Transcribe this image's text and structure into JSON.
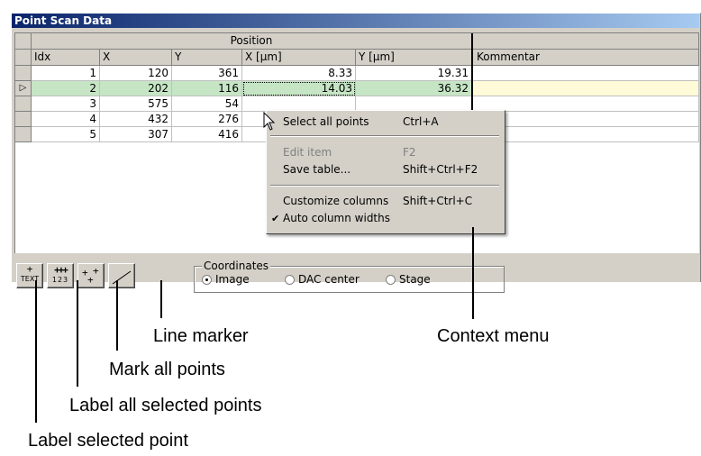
{
  "window": {
    "title": "Point Scan Data"
  },
  "table": {
    "group_header": "Position",
    "columns": [
      "Idx",
      "X",
      "Y",
      "X [µm]",
      "Y [µm]",
      "Kommentar"
    ],
    "rows": [
      {
        "idx": "1",
        "x": "120",
        "y": "361",
        "xum": "8.33",
        "yum": "19.31",
        "comment": ""
      },
      {
        "idx": "2",
        "x": "202",
        "y": "116",
        "xum": "14.03",
        "yum": "36.32",
        "comment": ""
      },
      {
        "idx": "3",
        "x": "575",
        "y": "54",
        "xum": "",
        "yum": "",
        "comment": ""
      },
      {
        "idx": "4",
        "x": "432",
        "y": "276",
        "xum": "",
        "yum": "",
        "comment": ""
      },
      {
        "idx": "5",
        "x": "307",
        "y": "416",
        "xum": "",
        "yum": "",
        "comment": ""
      }
    ],
    "current_row_marker": "▷"
  },
  "context_menu": {
    "items": [
      {
        "label": "Select all points",
        "shortcut": "Ctrl+A",
        "enabled": true
      },
      {
        "label": "Edit item",
        "shortcut": "F2",
        "enabled": false
      },
      {
        "label": "Save table...",
        "shortcut": "Shift+Ctrl+F2",
        "enabled": true
      },
      {
        "label": "Customize columns",
        "shortcut": "Shift+Ctrl+C",
        "enabled": true
      },
      {
        "label": "Auto column widths",
        "shortcut": "",
        "enabled": true,
        "checked": true
      }
    ]
  },
  "toolbar": {
    "text_button_label": "TEXT",
    "label_all_digits": "123"
  },
  "coordinates": {
    "legend": "Coordinates",
    "options": [
      "Image",
      "DAC center",
      "Stage"
    ],
    "selected": "Image"
  },
  "callouts": {
    "line_marker": "Line marker",
    "context_menu": "Context menu",
    "mark_all": "Mark all points",
    "label_all_selected": "Label all selected points",
    "label_selected": "Label selected point"
  },
  "colors": {
    "selected_row": "#c5e5c5",
    "selected_comment": "#fffbd8",
    "title_start": "#0a246a",
    "title_end": "#a6caf0"
  }
}
